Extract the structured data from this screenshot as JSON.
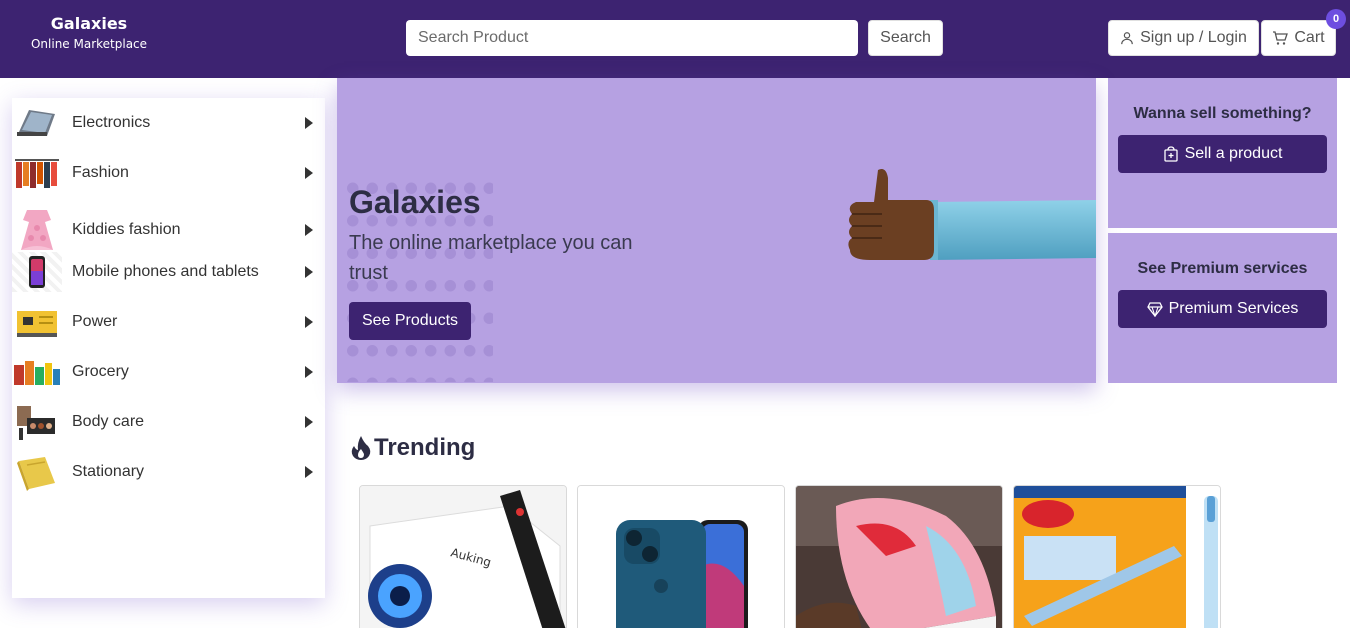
{
  "brand": {
    "name": "Galaxies",
    "tagline": "Online Marketplace"
  },
  "search": {
    "placeholder": "Search Product",
    "button_label": "Search"
  },
  "account": {
    "login_label": "Sign up / Login",
    "cart_label": "Cart",
    "cart_count": "0"
  },
  "sidebar": {
    "items": [
      {
        "label": "Electronics",
        "icon": "tablet-icon"
      },
      {
        "label": "Fashion",
        "icon": "clothes-rack-icon"
      },
      {
        "label": "Kiddies fashion",
        "icon": "baby-dress-icon"
      },
      {
        "label": "Mobile phones and tablets",
        "icon": "phone-icon"
      },
      {
        "label": "Power",
        "icon": "generator-icon"
      },
      {
        "label": "Grocery",
        "icon": "grocery-icon"
      },
      {
        "label": "Body care",
        "icon": "cosmetics-icon"
      },
      {
        "label": "Stationary",
        "icon": "book-icon"
      }
    ]
  },
  "hero": {
    "title": "Galaxies",
    "subtitle": "The online marketplace you can trust",
    "button_label": "See Products"
  },
  "promos": {
    "sell": {
      "title": "Wanna sell something?",
      "button_label": "Sell a product"
    },
    "premium": {
      "title": "See Premium services",
      "button_label": "Premium Services"
    }
  },
  "trending": {
    "title": "Trending",
    "products": [
      {
        "icon": "projector-icon"
      },
      {
        "icon": "iphone-icon"
      },
      {
        "icon": "sneaker-icon"
      },
      {
        "icon": "pen-box-icon"
      }
    ]
  },
  "colors": {
    "header_bg": "#3d2371",
    "panel_bg": "#b6a1e2",
    "button_bg": "#3d2371",
    "badge_bg": "#6d4ee0"
  }
}
